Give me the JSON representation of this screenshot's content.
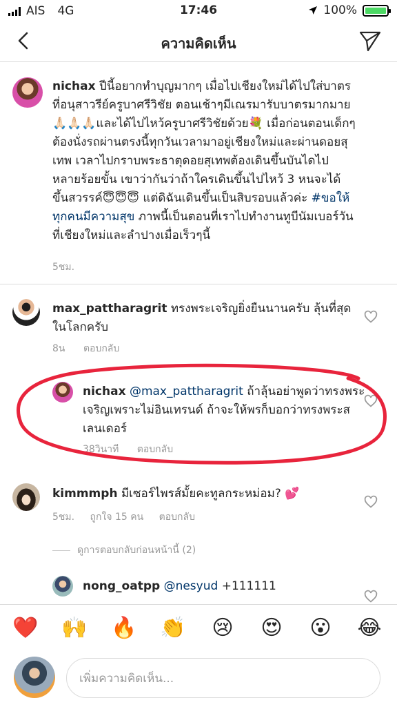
{
  "status_bar": {
    "carrier": "AIS",
    "network": "4G",
    "time": "17:46",
    "battery_percent_text": "100%",
    "battery_level": 1.0,
    "battery_color": "#4cd964"
  },
  "nav": {
    "title": "ความคิดเห็น",
    "back_icon": "chevron-left-icon",
    "send_icon": "paper-plane-icon"
  },
  "caption": {
    "username": "nichax",
    "text_before_tag": " ปีนี้อยากทำบุญมากๆ เมื่อไปเชียงใหม่ได้ไปใส่บาตรที่อนุสาวรีย์ครูบาศรีวิชัย ตอนเช้าๆมีเณรมารับบาตรมากมาย🙏🏻🙏🏻🙏🏻และได้ไปไหว้ครูบาศรีวิชัยด้วย💐 เมื่อก่อนตอนเด็กๆต้องนั่งรถผ่านตรงนี้ทุกวันเวลามาอยู่เชียงใหม่และผ่านดอยสุเทพ เวลาไปกราบพระธาตุดอยสุเทพต้องเดินขึ้นบันไดไปหลายร้อยขั้น เขาว่ากันว่าถ้าใครเดินขึ้นไปไหว้ 3 หนจะได้ขึ้นสวรรค์😇😇😇 แต่ดิฉันเดินขึ้นเป็นสิบรอบแล้วค่ะ ",
    "hashtag": "#ขอให้ทุกคนมีความสุข",
    "text_after_tag": " ภาพนี้เป็นตอนที่เราไปทำงานทูบีนัมเบอร์วันที่เชียงใหม่และลำปางเมื่อเร็วๆนี้",
    "time": "5ชม."
  },
  "comments": [
    {
      "username": "max_pattharagrit",
      "text": " ทรงพระเจริญยิ่งยืนนานครับ ลุ้นที่สุดในโลกครับ",
      "time": "8น",
      "reply_label": "ตอบกลับ"
    },
    {
      "username": "nichax",
      "mention": "@max_pattharagrit",
      "text": " ถ้าลุ้นอย่าพูดว่าทรงพระเจริญเพราะไม่อินเทรนด์ ถ้าจะให้พรก็บอกว่าทรงพระสเลนเดอร์",
      "time": "38วินาที",
      "reply_label": "ตอบกลับ"
    },
    {
      "username": "kimmmph",
      "text": " มีเซอร์ไพรส์มั้ยคะทูลกระหม่อม? 💕",
      "time": "5ชม.",
      "likes": "ถูกใจ 15 คน",
      "reply_label": "ตอบกลับ"
    },
    {
      "username": "nong_oatpp",
      "mention": "@nesyud",
      "text": " +111111"
    }
  ],
  "view_previous_replies": "ดูการตอบกลับก่อนหน้านี้ (2)",
  "emoji_bar": [
    "❤️",
    "🙌",
    "🔥",
    "👏",
    "😢",
    "😍",
    "😮",
    "😂"
  ],
  "compose": {
    "placeholder": "เพิ่มความคิดเห็น..."
  },
  "annotation_color": "#e8243c"
}
